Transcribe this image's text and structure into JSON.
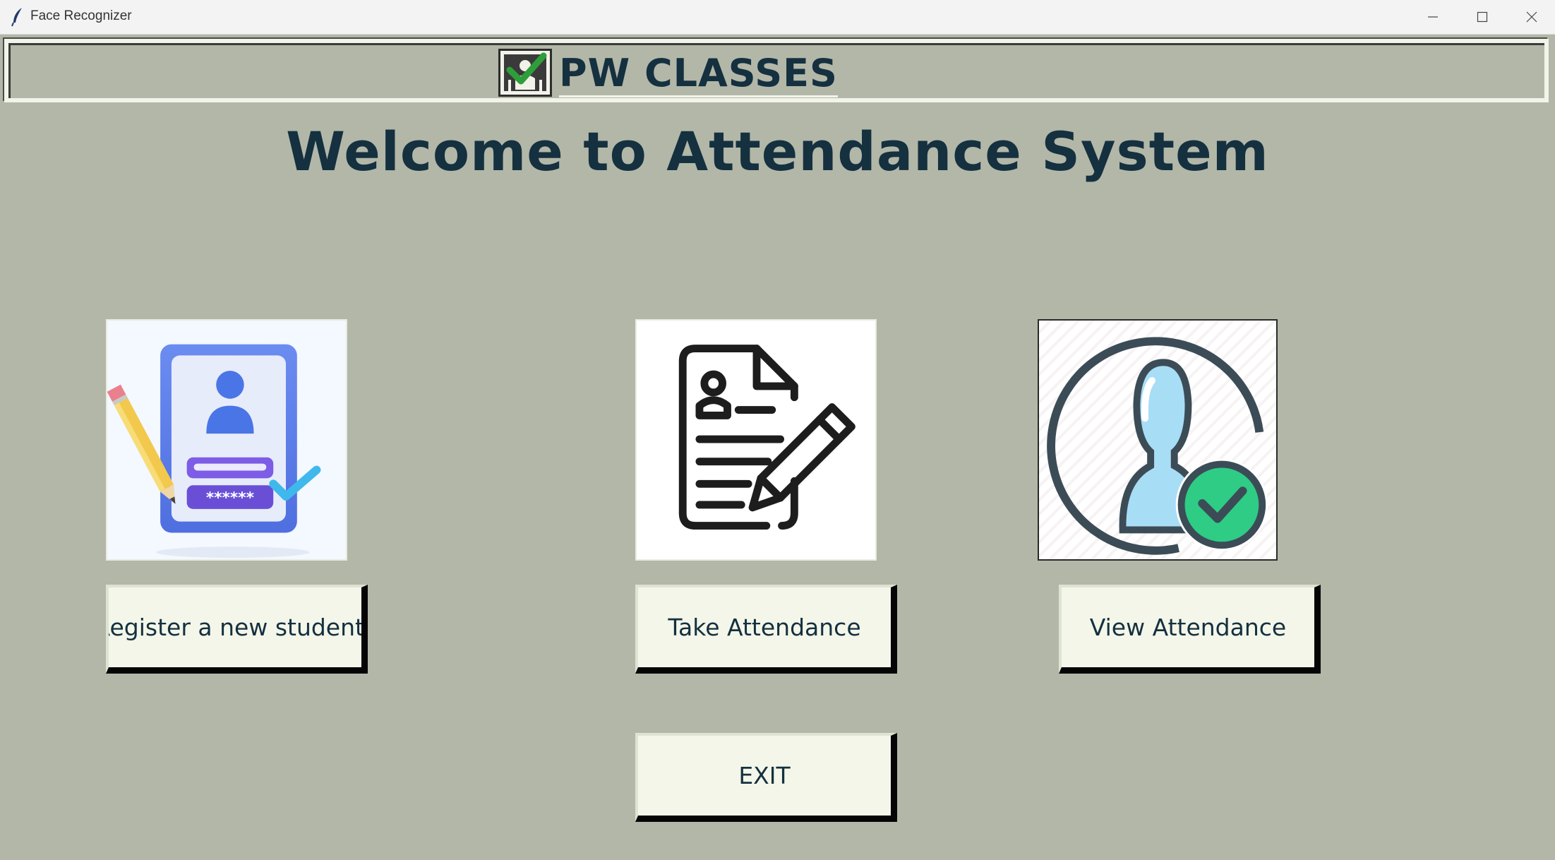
{
  "window": {
    "title": "Face Recognizer"
  },
  "header": {
    "brand": "PW CLASSES",
    "welcome": "Welcome to Attendance System"
  },
  "actions": {
    "register_label": "Register a new student",
    "take_label": "Take Attendance",
    "view_label": "View Attendance",
    "exit_label": "EXIT"
  },
  "icons": {
    "app": "feather-icon",
    "logo": "attendance-check-icon",
    "register": "student-id-card-icon",
    "take": "document-pen-icon",
    "view": "user-check-icon"
  },
  "colors": {
    "background": "#b2b7a8",
    "heading": "#15303f",
    "button_face": "#f3f6e9",
    "check_green": "#2ecc85"
  }
}
